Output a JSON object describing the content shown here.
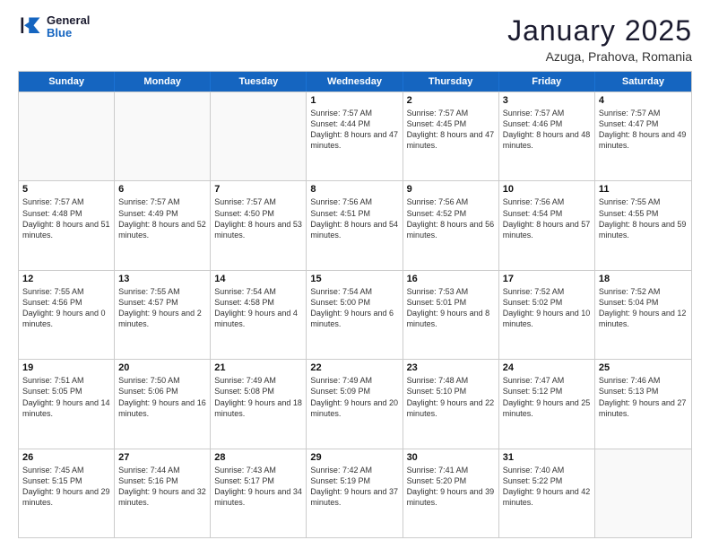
{
  "logo": {
    "line1": "General",
    "line2": "Blue"
  },
  "title": "January 2025",
  "subtitle": "Azuga, Prahova, Romania",
  "days": [
    "Sunday",
    "Monday",
    "Tuesday",
    "Wednesday",
    "Thursday",
    "Friday",
    "Saturday"
  ],
  "weeks": [
    [
      {
        "day": "",
        "text": ""
      },
      {
        "day": "",
        "text": ""
      },
      {
        "day": "",
        "text": ""
      },
      {
        "day": "1",
        "text": "Sunrise: 7:57 AM\nSunset: 4:44 PM\nDaylight: 8 hours and 47 minutes."
      },
      {
        "day": "2",
        "text": "Sunrise: 7:57 AM\nSunset: 4:45 PM\nDaylight: 8 hours and 47 minutes."
      },
      {
        "day": "3",
        "text": "Sunrise: 7:57 AM\nSunset: 4:46 PM\nDaylight: 8 hours and 48 minutes."
      },
      {
        "day": "4",
        "text": "Sunrise: 7:57 AM\nSunset: 4:47 PM\nDaylight: 8 hours and 49 minutes."
      }
    ],
    [
      {
        "day": "5",
        "text": "Sunrise: 7:57 AM\nSunset: 4:48 PM\nDaylight: 8 hours and 51 minutes."
      },
      {
        "day": "6",
        "text": "Sunrise: 7:57 AM\nSunset: 4:49 PM\nDaylight: 8 hours and 52 minutes."
      },
      {
        "day": "7",
        "text": "Sunrise: 7:57 AM\nSunset: 4:50 PM\nDaylight: 8 hours and 53 minutes."
      },
      {
        "day": "8",
        "text": "Sunrise: 7:56 AM\nSunset: 4:51 PM\nDaylight: 8 hours and 54 minutes."
      },
      {
        "day": "9",
        "text": "Sunrise: 7:56 AM\nSunset: 4:52 PM\nDaylight: 8 hours and 56 minutes."
      },
      {
        "day": "10",
        "text": "Sunrise: 7:56 AM\nSunset: 4:54 PM\nDaylight: 8 hours and 57 minutes."
      },
      {
        "day": "11",
        "text": "Sunrise: 7:55 AM\nSunset: 4:55 PM\nDaylight: 8 hours and 59 minutes."
      }
    ],
    [
      {
        "day": "12",
        "text": "Sunrise: 7:55 AM\nSunset: 4:56 PM\nDaylight: 9 hours and 0 minutes."
      },
      {
        "day": "13",
        "text": "Sunrise: 7:55 AM\nSunset: 4:57 PM\nDaylight: 9 hours and 2 minutes."
      },
      {
        "day": "14",
        "text": "Sunrise: 7:54 AM\nSunset: 4:58 PM\nDaylight: 9 hours and 4 minutes."
      },
      {
        "day": "15",
        "text": "Sunrise: 7:54 AM\nSunset: 5:00 PM\nDaylight: 9 hours and 6 minutes."
      },
      {
        "day": "16",
        "text": "Sunrise: 7:53 AM\nSunset: 5:01 PM\nDaylight: 9 hours and 8 minutes."
      },
      {
        "day": "17",
        "text": "Sunrise: 7:52 AM\nSunset: 5:02 PM\nDaylight: 9 hours and 10 minutes."
      },
      {
        "day": "18",
        "text": "Sunrise: 7:52 AM\nSunset: 5:04 PM\nDaylight: 9 hours and 12 minutes."
      }
    ],
    [
      {
        "day": "19",
        "text": "Sunrise: 7:51 AM\nSunset: 5:05 PM\nDaylight: 9 hours and 14 minutes."
      },
      {
        "day": "20",
        "text": "Sunrise: 7:50 AM\nSunset: 5:06 PM\nDaylight: 9 hours and 16 minutes."
      },
      {
        "day": "21",
        "text": "Sunrise: 7:49 AM\nSunset: 5:08 PM\nDaylight: 9 hours and 18 minutes."
      },
      {
        "day": "22",
        "text": "Sunrise: 7:49 AM\nSunset: 5:09 PM\nDaylight: 9 hours and 20 minutes."
      },
      {
        "day": "23",
        "text": "Sunrise: 7:48 AM\nSunset: 5:10 PM\nDaylight: 9 hours and 22 minutes."
      },
      {
        "day": "24",
        "text": "Sunrise: 7:47 AM\nSunset: 5:12 PM\nDaylight: 9 hours and 25 minutes."
      },
      {
        "day": "25",
        "text": "Sunrise: 7:46 AM\nSunset: 5:13 PM\nDaylight: 9 hours and 27 minutes."
      }
    ],
    [
      {
        "day": "26",
        "text": "Sunrise: 7:45 AM\nSunset: 5:15 PM\nDaylight: 9 hours and 29 minutes."
      },
      {
        "day": "27",
        "text": "Sunrise: 7:44 AM\nSunset: 5:16 PM\nDaylight: 9 hours and 32 minutes."
      },
      {
        "day": "28",
        "text": "Sunrise: 7:43 AM\nSunset: 5:17 PM\nDaylight: 9 hours and 34 minutes."
      },
      {
        "day": "29",
        "text": "Sunrise: 7:42 AM\nSunset: 5:19 PM\nDaylight: 9 hours and 37 minutes."
      },
      {
        "day": "30",
        "text": "Sunrise: 7:41 AM\nSunset: 5:20 PM\nDaylight: 9 hours and 39 minutes."
      },
      {
        "day": "31",
        "text": "Sunrise: 7:40 AM\nSunset: 5:22 PM\nDaylight: 9 hours and 42 minutes."
      },
      {
        "day": "",
        "text": ""
      }
    ]
  ]
}
